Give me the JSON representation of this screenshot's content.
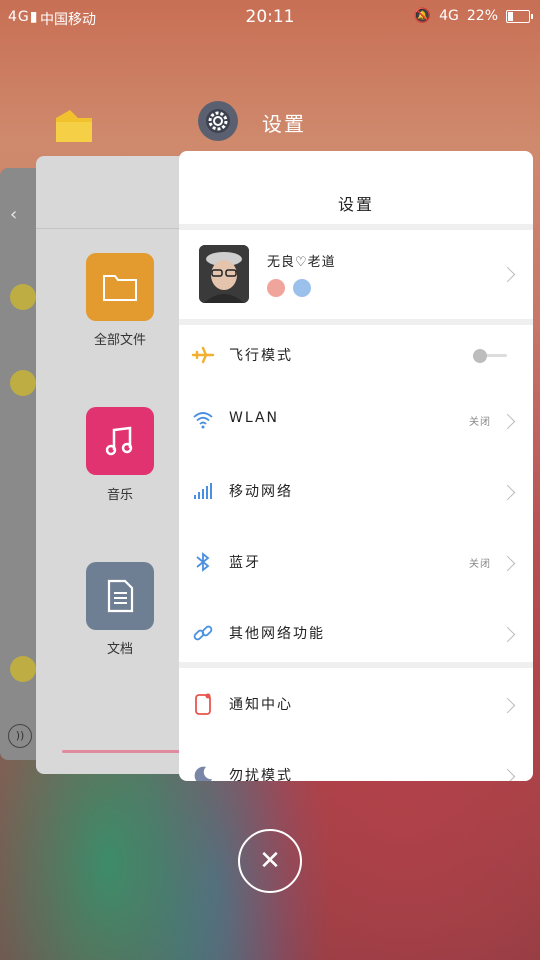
{
  "status_bar": {
    "signal": "4G",
    "carrier": "中国移动",
    "time": "20:11",
    "network": "4G",
    "battery": "22%",
    "battery_level": 0.22
  },
  "recents": {
    "active_app_title": "设置",
    "active_app_icon": "gear-icon",
    "files_card": {
      "tiles": [
        {
          "label": "全部文件",
          "icon": "folder-icon",
          "color": "#e39a2f"
        },
        {
          "label": "音乐",
          "icon": "music-note-icon",
          "color": "#e0336f"
        },
        {
          "label": "文档",
          "icon": "document-icon",
          "color": "#6f7f93"
        }
      ]
    }
  },
  "settings": {
    "title": "设置",
    "profile": {
      "name": "无良♡老道"
    },
    "rows": [
      {
        "label": "飞行模式",
        "icon": "airplane-icon",
        "status": "",
        "toggle": false
      },
      {
        "label": "WLAN",
        "icon": "wifi-icon",
        "status": "关闭"
      },
      {
        "label": "移动网络",
        "icon": "signal-bars-icon",
        "status": ""
      },
      {
        "label": "蓝牙",
        "icon": "bluetooth-icon",
        "status": "关闭"
      },
      {
        "label": "其他网络功能",
        "icon": "link-icon",
        "status": ""
      },
      {
        "label": "通知中心",
        "icon": "notification-icon",
        "status": ""
      },
      {
        "label": "勿扰模式",
        "icon": "moon-icon",
        "status": ""
      }
    ]
  },
  "colors": {
    "airplane": "#f2b02e",
    "network_blue": "#4a90e2",
    "notification_red": "#e8554e"
  }
}
